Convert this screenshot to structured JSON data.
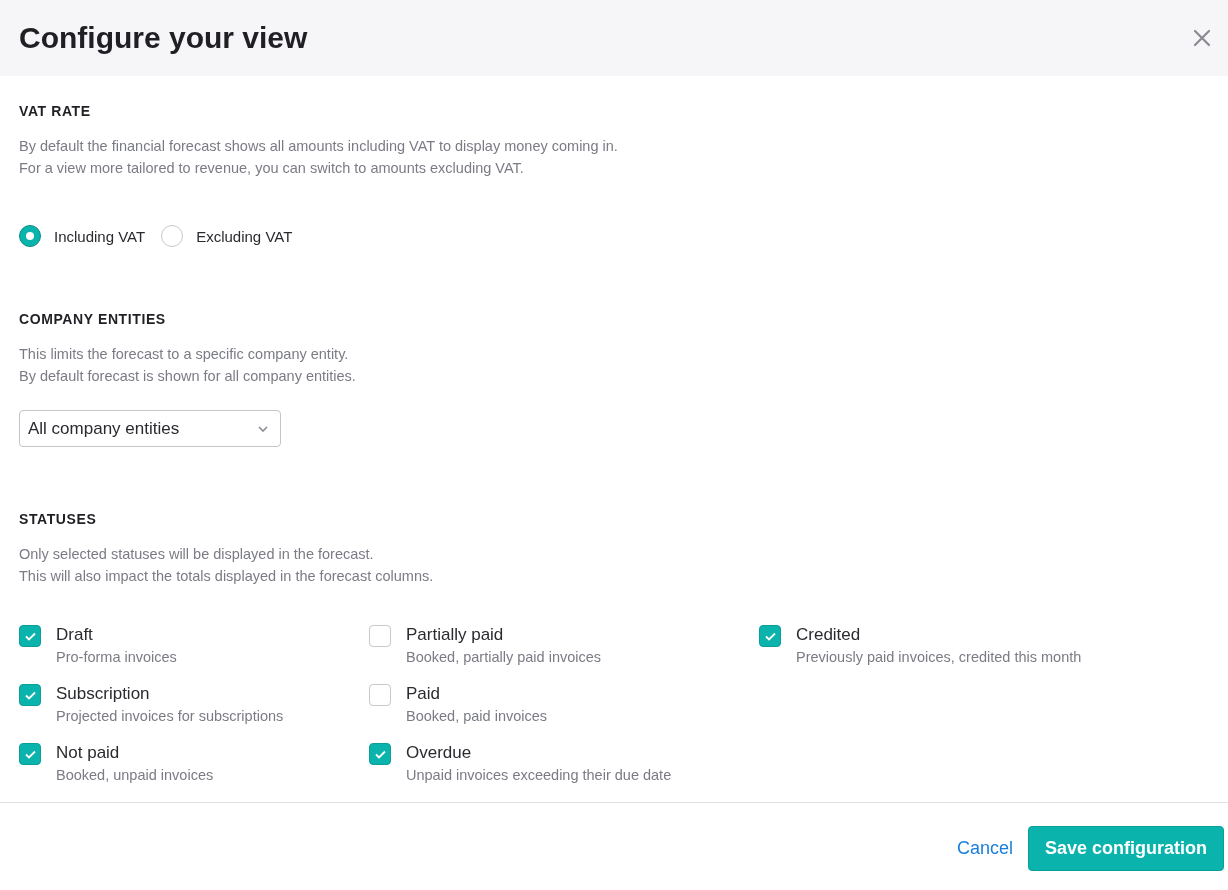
{
  "dialog": {
    "title": "Configure your view"
  },
  "vat_rate": {
    "heading": "VAT RATE",
    "description": [
      "By default the financial forecast shows all amounts including VAT to display money coming in.",
      "For a view more tailored to revenue, you can switch to amounts excluding VAT."
    ],
    "options": [
      {
        "label": "Including VAT",
        "selected": true
      },
      {
        "label": "Excluding VAT",
        "selected": false
      }
    ]
  },
  "company_entities": {
    "heading": "COMPANY ENTITIES",
    "description": [
      "This limits the forecast to a specific company entity.",
      "By default forecast is shown for all company entities."
    ],
    "select": {
      "value": "All company entities"
    }
  },
  "statuses": {
    "heading": "STATUSES",
    "description": [
      "Only selected statuses will be displayed in the forecast.",
      "This will also impact the totals displayed in the forecast columns."
    ],
    "items": [
      {
        "label": "Draft",
        "hint": "Pro-forma invoices",
        "checked": true
      },
      {
        "label": "Subscription",
        "hint": "Projected invoices for subscriptions",
        "checked": true
      },
      {
        "label": "Not paid",
        "hint": "Booked, unpaid invoices",
        "checked": true
      },
      {
        "label": "Partially paid",
        "hint": "Booked, partially paid invoices",
        "checked": false
      },
      {
        "label": "Paid",
        "hint": "Booked, paid invoices",
        "checked": false
      },
      {
        "label": "Overdue",
        "hint": "Unpaid invoices exceeding their due date",
        "checked": true
      },
      {
        "label": "Credited",
        "hint": "Previously paid invoices, credited this month",
        "checked": true
      }
    ]
  },
  "footer": {
    "buttons": [
      {
        "label": "Cancel",
        "kind": "link"
      },
      {
        "label": "Save configuration",
        "kind": "primary"
      }
    ]
  }
}
